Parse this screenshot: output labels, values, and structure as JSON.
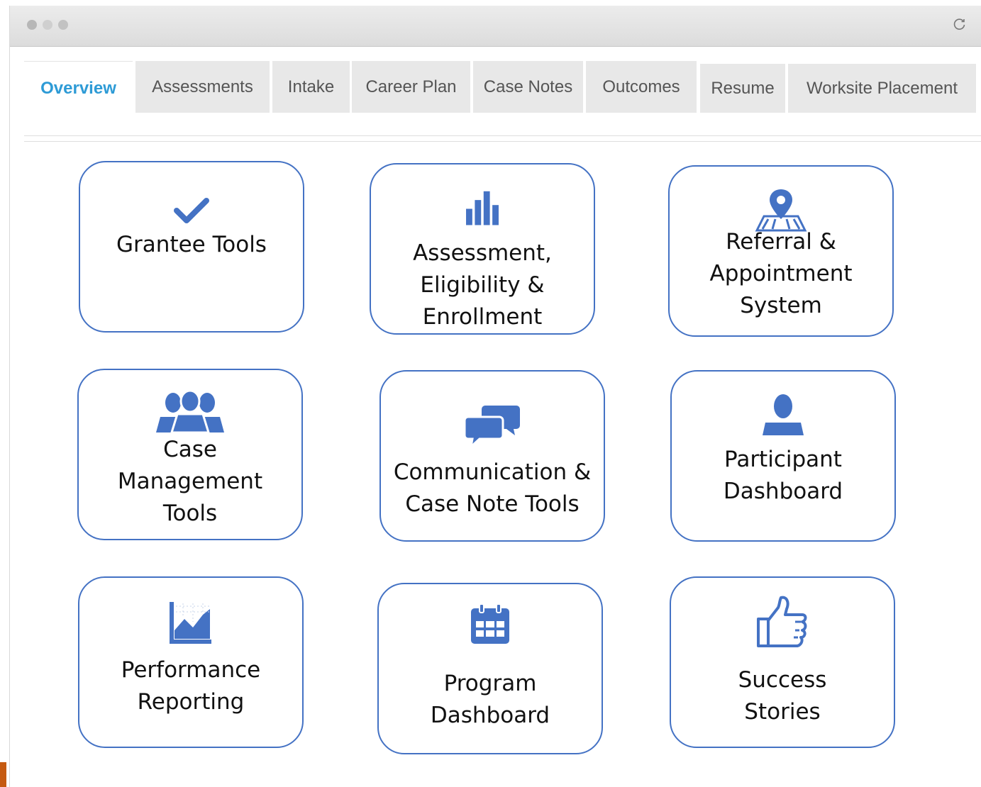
{
  "window": {
    "controls": [
      "close",
      "minimize",
      "zoom"
    ],
    "reload_icon": "reload-icon"
  },
  "tabs": [
    {
      "label": "Overview",
      "active": true
    },
    {
      "label": "Assessments",
      "active": false
    },
    {
      "label": "Intake",
      "active": false
    },
    {
      "label": "Career Plan",
      "active": false
    },
    {
      "label": "Case Notes",
      "active": false
    },
    {
      "label": "Outcomes",
      "active": false
    },
    {
      "label": "Resume",
      "active": false
    },
    {
      "label": "Worksite Placement",
      "active": false
    }
  ],
  "colors": {
    "accent": "#2e9bd6",
    "card_border": "#4472c4",
    "icon": "#4472c4",
    "tab_bg": "#e8e8e8"
  },
  "cards": [
    {
      "label": "Grantee Tools",
      "icon": "checkmark-icon"
    },
    {
      "label": "Assessment,\nEligibility &\nEnrollment",
      "icon": "bar-chart-icon"
    },
    {
      "label": "Referral &\nAppointment\nSystem",
      "icon": "map-pin-icon"
    },
    {
      "label": "Case\nManagement\nTools",
      "icon": "group-icon"
    },
    {
      "label": "Communication &\nCase Note Tools",
      "icon": "chat-bubbles-icon"
    },
    {
      "label": "Participant\nDashboard",
      "icon": "person-icon"
    },
    {
      "label": "Performance\nReporting",
      "icon": "area-chart-icon"
    },
    {
      "label": "Program\nDashboard",
      "icon": "calendar-icon"
    },
    {
      "label": "Success\nStories",
      "icon": "thumbs-up-icon"
    }
  ]
}
